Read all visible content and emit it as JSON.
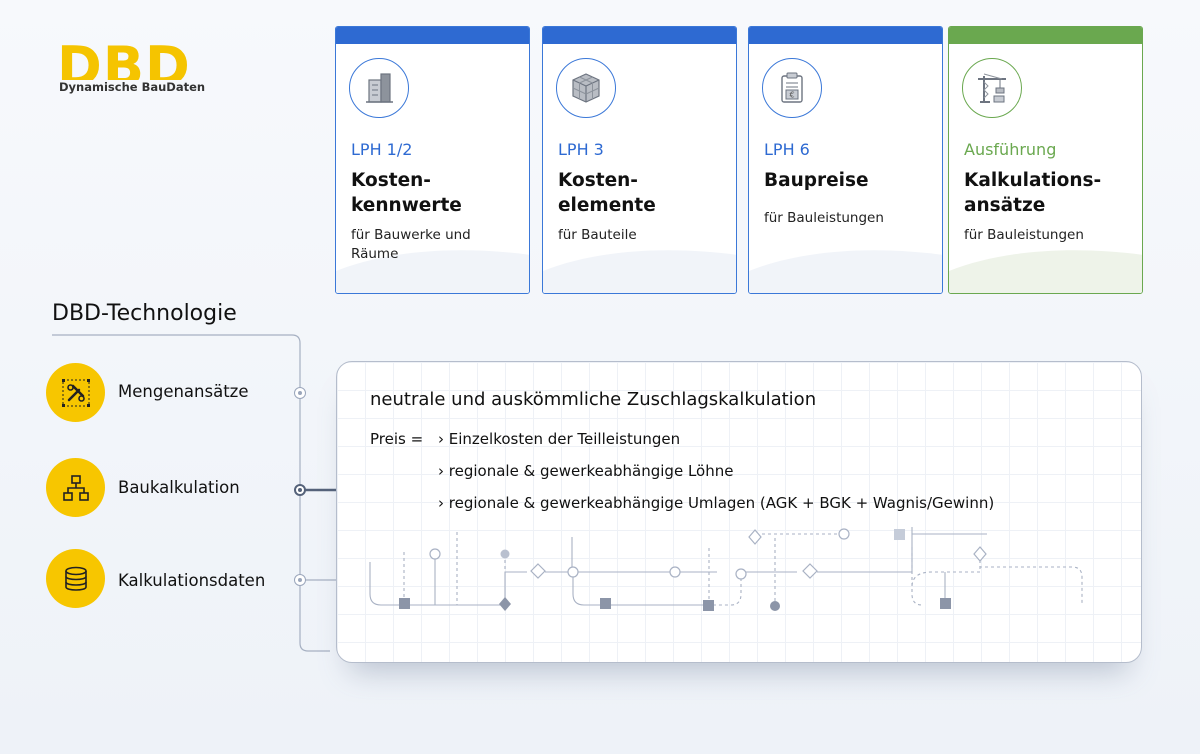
{
  "logo": {
    "mark": "DBD",
    "subtitle": "Dynamische BauDaten",
    "color": "#f5c400"
  },
  "cards": [
    {
      "phase": "LPH 1/2",
      "title_line1": "Kosten-",
      "title_line2": "kennwerte",
      "subtitle_line1": "für Bauwerke und",
      "subtitle_line2": "Räume",
      "icon": "building-icon",
      "accent": "#2e6ad2"
    },
    {
      "phase": "LPH 3",
      "title_line1": "Kosten-",
      "title_line2": "elemente",
      "subtitle_line1": "für Bauteile",
      "icon": "cubes-icon",
      "accent": "#2e6ad2"
    },
    {
      "phase": "LPH 6",
      "title_line1": "Baupreise",
      "subtitle_line1": "für Bauleistungen",
      "icon": "price-document-icon",
      "accent": "#2e6ad2"
    },
    {
      "phase": "Ausführung",
      "title_line1": "Kalkulations-",
      "title_line2": "ansätze",
      "subtitle_line1": "für Bauleistungen",
      "icon": "crane-icon",
      "accent": "#6aa84f"
    }
  ],
  "technology": {
    "title": "DBD-Technologie",
    "items": [
      {
        "label": "Mengenansätze",
        "icon": "tools-icon"
      },
      {
        "label": "Baukalkulation",
        "icon": "hierarchy-icon"
      },
      {
        "label": "Kalkulationsdaten",
        "icon": "database-icon"
      }
    ],
    "accent": "#f7c600"
  },
  "calculation": {
    "heading": "neutrale und auskömmliche Zuschlagskalkulation",
    "formula_label": "Preis =",
    "items": [
      "› Einzelkosten der Teilleistungen",
      "› regionale & gewerkeabhängige Löhne",
      "› regionale & gewerkeabhängige Umlagen (AGK + BGK + Wagnis/Gewinn)"
    ]
  }
}
